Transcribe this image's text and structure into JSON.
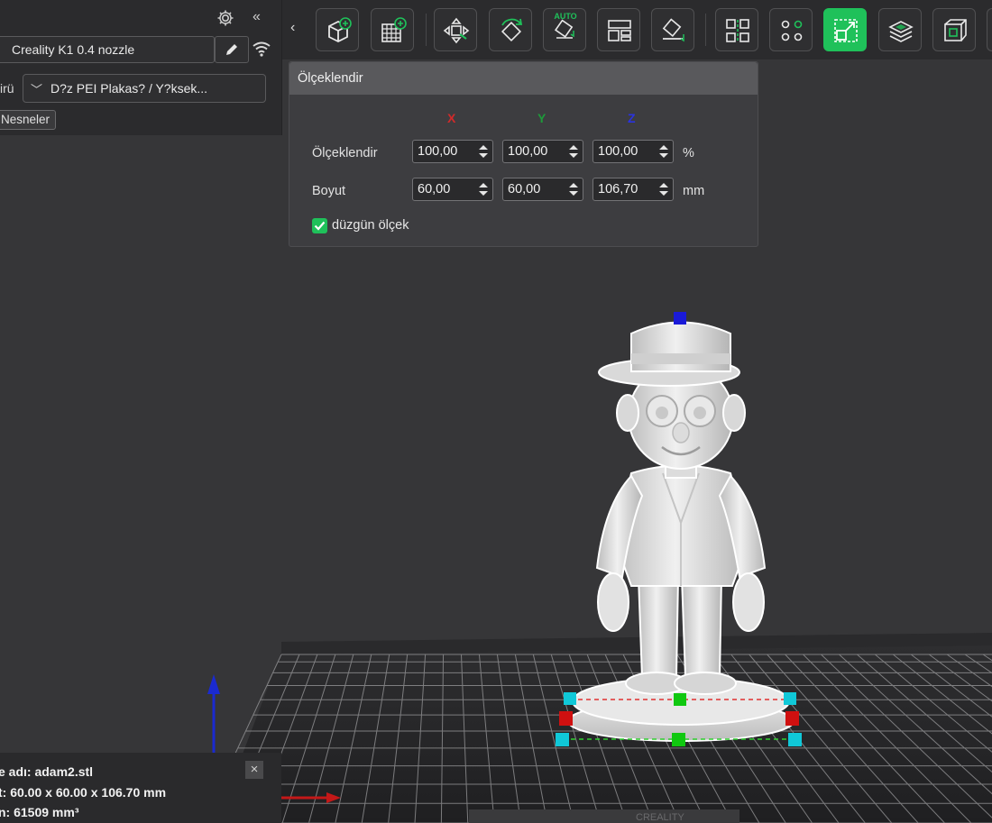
{
  "left_panel": {
    "printer": "Creality K1 0.4 nozzle",
    "plate_label": "irü",
    "plate_value": "D?z PEI Plakas? / Y?ksek...",
    "objects_tab": "Nesneler",
    "icons": [
      "gear-icon",
      "collapse-left-icon",
      "edit-pencil-icon",
      "wifi-icon",
      "chevron-down-icon"
    ]
  },
  "toolbar": {
    "collapse_icon": "‹",
    "tools": [
      {
        "name": "add-object",
        "icon": "cube-plus-icon"
      },
      {
        "name": "add-plate",
        "icon": "grid-plus-icon"
      },
      {
        "name": "move",
        "icon": "move-arrows-icon"
      },
      {
        "name": "rotate",
        "icon": "rotate-icon"
      },
      {
        "name": "auto-orient",
        "icon": "auto-orient-icon",
        "text": "AUTO"
      },
      {
        "name": "arrange",
        "icon": "arrange-icon"
      },
      {
        "name": "lay-on-face",
        "icon": "lay-flat-icon"
      },
      {
        "name": "split",
        "icon": "split-icon"
      },
      {
        "name": "support",
        "icon": "support-icon"
      },
      {
        "name": "scale",
        "icon": "scale-icon",
        "active": true
      },
      {
        "name": "slice-view",
        "icon": "layers-icon"
      },
      {
        "name": "view-cube",
        "icon": "box-view-icon"
      }
    ],
    "accent": "#1fc15a"
  },
  "scale_panel": {
    "title": "Ölçeklendir",
    "axes": [
      {
        "label": "X",
        "color": "#d12a2a"
      },
      {
        "label": "Y",
        "color": "#1e9a3a"
      },
      {
        "label": "Z",
        "color": "#2a33e0"
      }
    ],
    "scale_row": {
      "label": "Ölçeklendir",
      "values": [
        "100,00",
        "100,00",
        "100,00"
      ],
      "unit": "%"
    },
    "size_row": {
      "label": "Boyut",
      "values": [
        "60,00",
        "60,00",
        "106,70"
      ],
      "unit": "mm"
    },
    "uniform": {
      "label": "düzgün ölçek",
      "checked": true
    }
  },
  "info": {
    "name": "e adı: adam2.stl",
    "size": "t: 60.00 x 60.00 x 106.70 mm",
    "volume": "n: 61509 mm³",
    "close_icon": "×"
  },
  "viewport": {
    "model": "figurine-man-with-hat",
    "bed_text": "CREALITY"
  }
}
